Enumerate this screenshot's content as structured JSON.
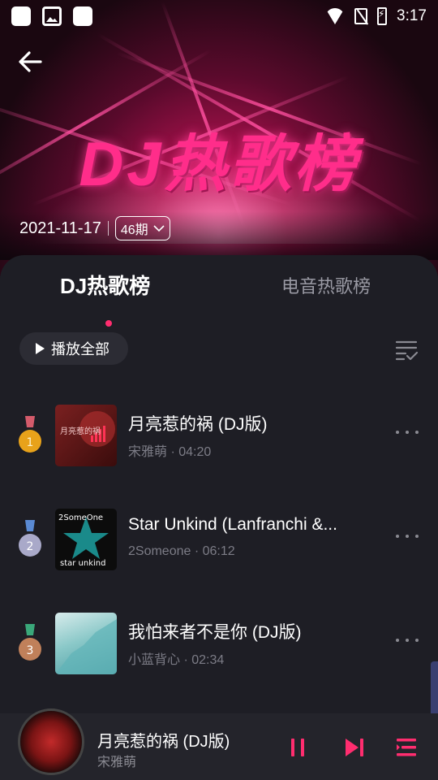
{
  "status_bar": {
    "time": "3:17"
  },
  "hero": {
    "title": "DJ热歌榜",
    "date": "2021-11-17",
    "period": "46期"
  },
  "tabs": [
    {
      "label": "DJ热歌榜",
      "active": true
    },
    {
      "label": "电音热歌榜",
      "active": false
    }
  ],
  "toolbar": {
    "play_all_label": "播放全部"
  },
  "songs": [
    {
      "rank": "1",
      "title": "月亮惹的祸 (DJ版)",
      "artist": "宋雅萌",
      "duration": "04:20",
      "medal_color": "#e8a21a"
    },
    {
      "rank": "2",
      "title": "Star Unkind (Lanfranchi &...",
      "artist": "2Someone",
      "duration": "06:12",
      "medal_color": "#a9a9c9"
    },
    {
      "rank": "3",
      "title": "我怕来者不是你 (DJ版)",
      "artist": "小蓝背心",
      "duration": "02:34",
      "medal_color": "#c0805a"
    }
  ],
  "covers": {
    "cover1_text": "月亮惹的祸",
    "cover2_top": "2SomeOne",
    "cover2_bottom": "star unkind"
  },
  "now_playing": {
    "title": "月亮惹的祸 (DJ版)",
    "artist": "宋雅萌"
  },
  "colors": {
    "accent": "#ff2d6f",
    "background": "#1e1e25"
  }
}
